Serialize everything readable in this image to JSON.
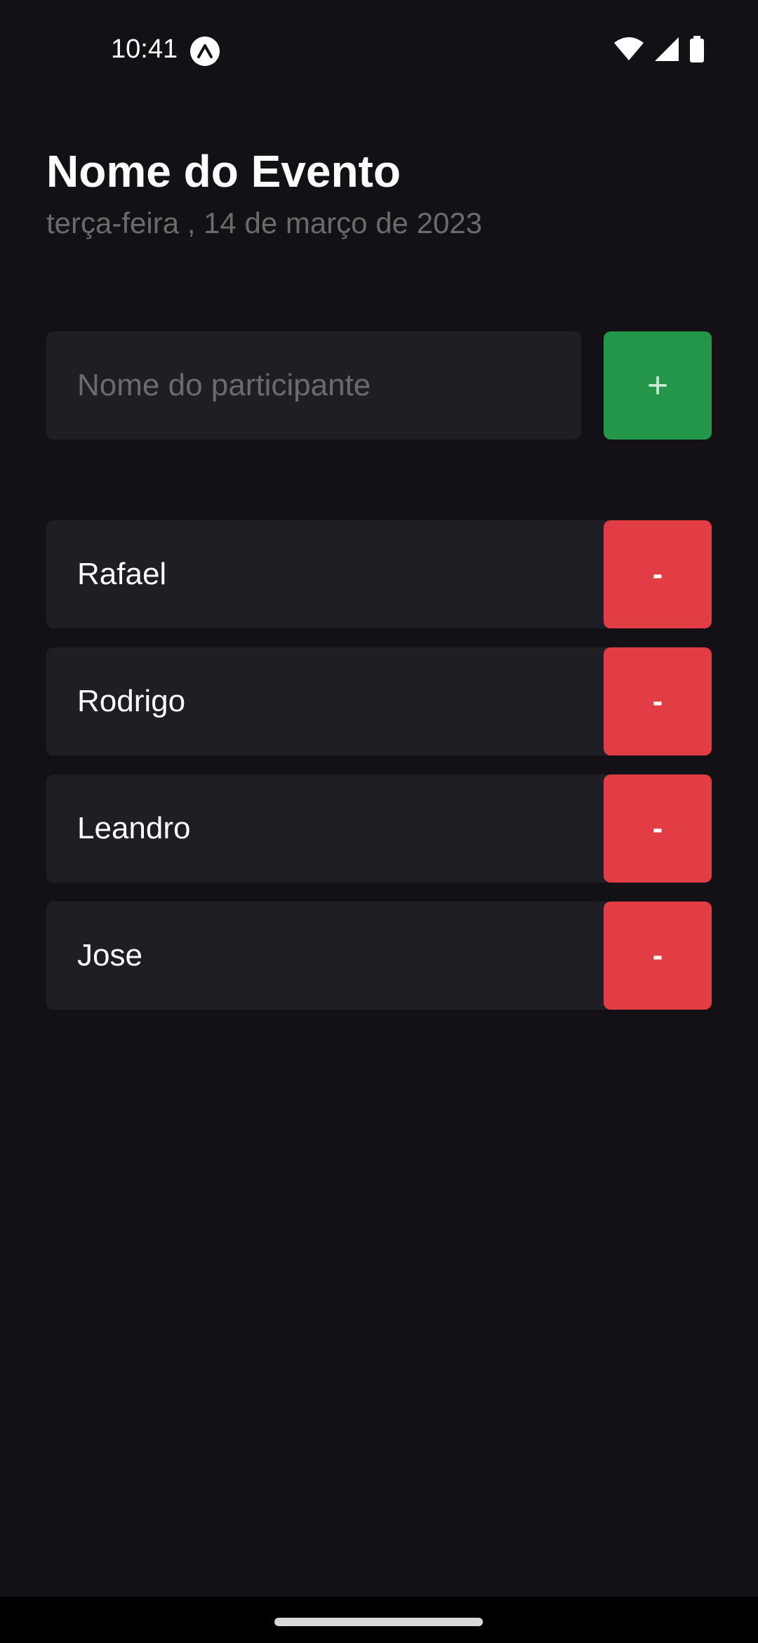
{
  "status_bar": {
    "time": "10:41"
  },
  "header": {
    "title": "Nome do Evento",
    "date": "terça-feira , 14 de março de 2023"
  },
  "form": {
    "input_placeholder": "Nome do participante",
    "input_value": "",
    "add_label": "+"
  },
  "participants": [
    {
      "name": "Rafael",
      "remove_label": "-"
    },
    {
      "name": "Rodrigo",
      "remove_label": "-"
    },
    {
      "name": "Leandro",
      "remove_label": "-"
    },
    {
      "name": "Jose",
      "remove_label": "-"
    }
  ],
  "colors": {
    "background": "#131016",
    "surface": "#1f1e25",
    "add_button": "#239649",
    "remove_button": "#e23c44",
    "muted_text": "#6b6b6b",
    "text": "#fdfcfe"
  },
  "icons": {
    "status_app": "expo-icon",
    "wifi": "wifi-icon",
    "signal": "cell-signal-icon",
    "battery": "battery-icon"
  }
}
